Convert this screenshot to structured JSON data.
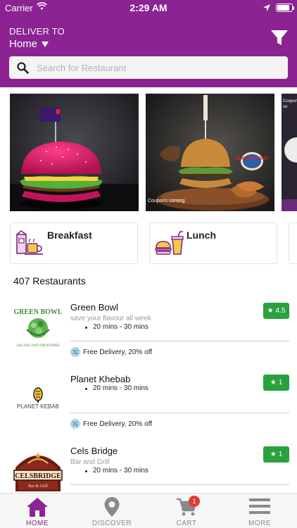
{
  "status": {
    "carrier": "Carrier",
    "time": "2:29 AM",
    "battery_level": 0.85
  },
  "header": {
    "deliver_to_label": "DELIVER TO",
    "location": "Home",
    "search_placeholder": "Search for Restaurant"
  },
  "banners": [
    {
      "name": "pink-burger-banner"
    },
    {
      "name": "burger-king-banner",
      "brand_text": "BURGER KING",
      "caption": "Coupons coming"
    },
    {
      "name": "partial-banner",
      "text": "Coupons so"
    }
  ],
  "categories": [
    {
      "label": "Breakfast",
      "icon": "breakfast-icon"
    },
    {
      "label": "Lunch",
      "icon": "lunch-icon"
    }
  ],
  "restaurant_count": "407 Restaurants",
  "restaurants": [
    {
      "name": "Green Bowl",
      "tagline": "save your flavour all week",
      "time": "20 mins - 30 mins",
      "rating": "4.5",
      "promo": "Free Delivery, 20% off",
      "logo_text": "GREEN BOWL"
    },
    {
      "name": "Planet Khebab",
      "tagline": "",
      "time": "20 mins - 30 mins",
      "rating": "1",
      "promo": "Free Delivery, 20% off",
      "logo_text": "PLANET KEBAB"
    },
    {
      "name": "Cels Bridge",
      "tagline": "Bar and Grill",
      "time": "20 mins - 30 mins",
      "rating": "1",
      "promo": "",
      "logo_text": "CELSBRIDGE"
    }
  ],
  "tabs": [
    {
      "label": "HOME",
      "icon": "home-icon",
      "active": true
    },
    {
      "label": "DISCOVER",
      "icon": "map-pin-icon",
      "active": false
    },
    {
      "label": "CART",
      "icon": "cart-icon",
      "active": false,
      "badge": "1"
    },
    {
      "label": "MORE",
      "icon": "menu-icon",
      "active": false
    }
  ],
  "colors": {
    "brand": "#8b2392",
    "rating": "#29a13f",
    "badge": "#e53935"
  }
}
